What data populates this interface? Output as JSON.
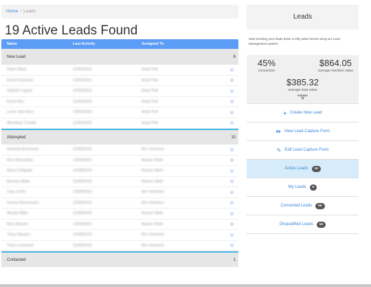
{
  "breadcrumb": {
    "home": "Home",
    "sep": "/",
    "current": "Leads"
  },
  "page_title": "19 Active Leads Found",
  "table": {
    "columns": [
      "Name",
      "Last Activity",
      "Assigned To"
    ],
    "groups": [
      {
        "label": "New Lead",
        "count": "6",
        "rows": [
          [
            "Dawn Mays",
            "12/05/2015",
            "Andy Pott"
          ],
          [
            "Ernest Sanchez",
            "12/05/2015",
            "Andy Pott"
          ],
          [
            "Gabriel Logans",
            "12/05/2015",
            "Andy Pott"
          ],
          [
            "Kevin Rex",
            "12/05/2015",
            "Andy Pott"
          ],
          [
            "Loren Van Ness",
            "12/05/2015",
            "Andy Pott"
          ],
          [
            "Woodrow Trouble",
            "12/05/2015",
            "Andy Pott"
          ]
        ]
      },
      {
        "label": "Attempted",
        "count": "10",
        "rows": [
          [
            "Amanda Buchanan",
            "12/08/2015",
            "Ben Solomon"
          ],
          [
            "Ana Hernandez",
            "12/08/2015",
            "Nasser Wahl"
          ],
          [
            "Arturo Delgado",
            "12/08/2015",
            "Nasser Wahl"
          ],
          [
            "Beverly Mabe",
            "12/08/2015",
            "Nasser Wahl"
          ],
          [
            "Clay of Dirt",
            "12/08/2015",
            "Ben Solomon"
          ],
          [
            "Donna Rasmussen",
            "12/08/2015",
            "Ben Solomon"
          ],
          [
            "Moody Miller",
            "12/08/2015",
            "Nasser Wahl"
          ],
          [
            "Nina Mauzel",
            "12/08/2015",
            "Nasser Wahl"
          ],
          [
            "Tracy Nguyen",
            "12/08/2015",
            "Ben Solomon"
          ],
          [
            "Trina Lockwood",
            "12/08/2015",
            "Ben Solomon"
          ]
        ]
      },
      {
        "label": "Contacted",
        "count": "1",
        "rows": []
      }
    ]
  },
  "panel": {
    "title": "Leads",
    "description": "Start tracking your leads down a nifty sales funnel using our Lead Management system.",
    "conversion_value": "45%",
    "conversion_label": "conversion",
    "member_value": "$864.05",
    "member_label": "average member value",
    "lead_value": "$385.32",
    "lead_label": "average lead value",
    "expand_label": "EXPAND"
  },
  "menu": {
    "create": "Create New Lead",
    "view_form": "View Lead Capture Form",
    "edit_form": "Edit Lead Capture Form",
    "active": {
      "label": "Active Leads",
      "count": "19"
    },
    "my": {
      "label": "My Leads",
      "count": "6"
    },
    "converted": {
      "label": "Converted Leads",
      "count": "66"
    },
    "disqualified": {
      "label": "Disqualified Leads",
      "count": "63"
    }
  },
  "colors": {
    "accent": "#5b9cf6",
    "link": "#3a87d8",
    "group_separator": "#45b5e6",
    "active_bg": "#d7ecfa"
  }
}
